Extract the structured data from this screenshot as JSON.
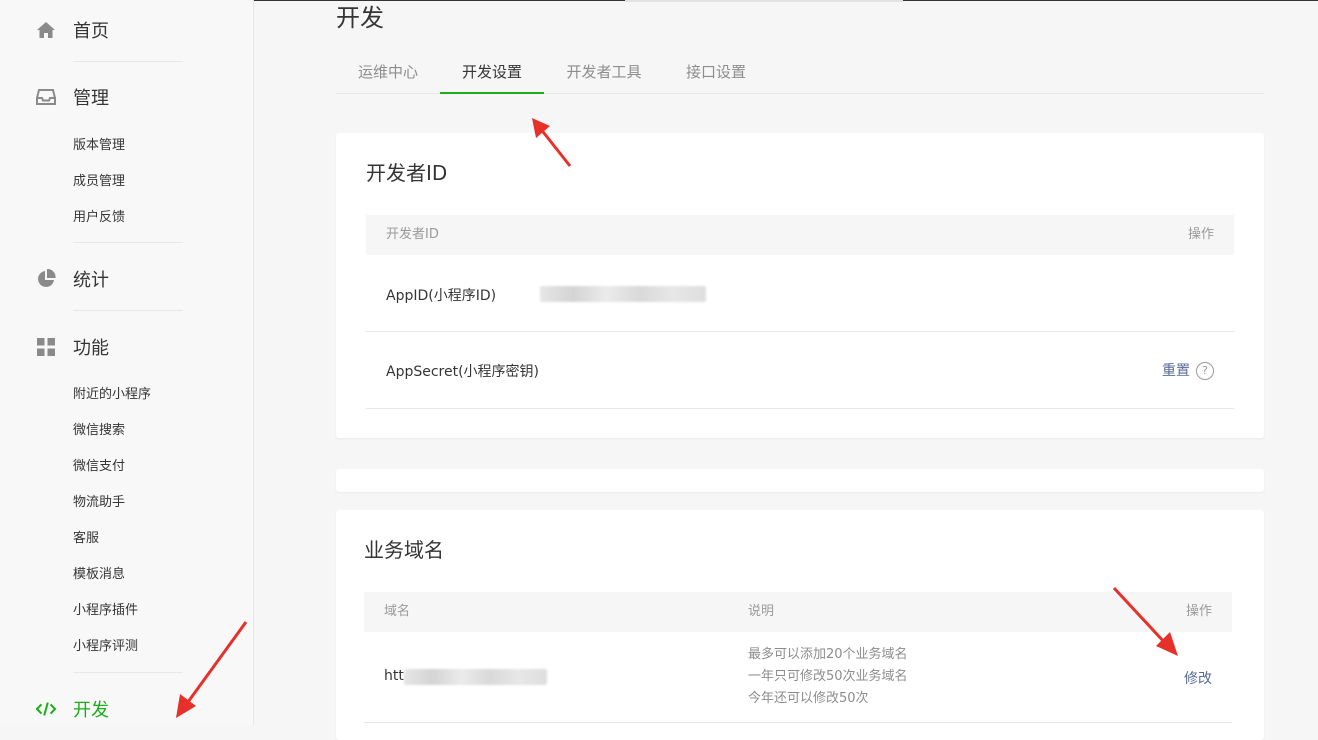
{
  "sidebar": {
    "home": {
      "label": "首页",
      "icon": "home-icon"
    },
    "manage": {
      "label": "管理",
      "icon": "inbox-icon",
      "items": [
        "版本管理",
        "成员管理",
        "用户反馈"
      ]
    },
    "stats": {
      "label": "统计",
      "icon": "pie-chart-icon"
    },
    "features": {
      "label": "功能",
      "icon": "grid-icon",
      "items": [
        "附近的小程序",
        "微信搜索",
        "微信支付",
        "物流助手",
        "客服",
        "模板消息",
        "小程序插件",
        "小程序评测"
      ]
    },
    "develop": {
      "label": "开发",
      "icon": "code-icon"
    }
  },
  "main": {
    "title": "开发",
    "tabs": [
      {
        "label": "运维中心",
        "active": false
      },
      {
        "label": "开发设置",
        "active": true
      },
      {
        "label": "开发者工具",
        "active": false
      },
      {
        "label": "接口设置",
        "active": false
      }
    ],
    "developer_id": {
      "title": "开发者ID",
      "headers": [
        "开发者ID",
        "操作"
      ],
      "rows": [
        {
          "label": "AppID(小程序ID)",
          "value_hidden": true
        },
        {
          "label": "AppSecret(小程序密钥)",
          "action": "重置",
          "help": "?"
        }
      ]
    },
    "domain": {
      "title": "业务域名",
      "headers": [
        "域名",
        "说明",
        "操作"
      ],
      "row": {
        "domain_prefix": "htt",
        "desc": [
          "最多可以添加20个业务域名",
          "一年只可修改50次业务域名",
          "今年还可以修改50次"
        ],
        "action": "修改"
      }
    }
  },
  "colors": {
    "accent": "#1aad19",
    "link": "#576b95",
    "arrow": "#e8302a"
  }
}
